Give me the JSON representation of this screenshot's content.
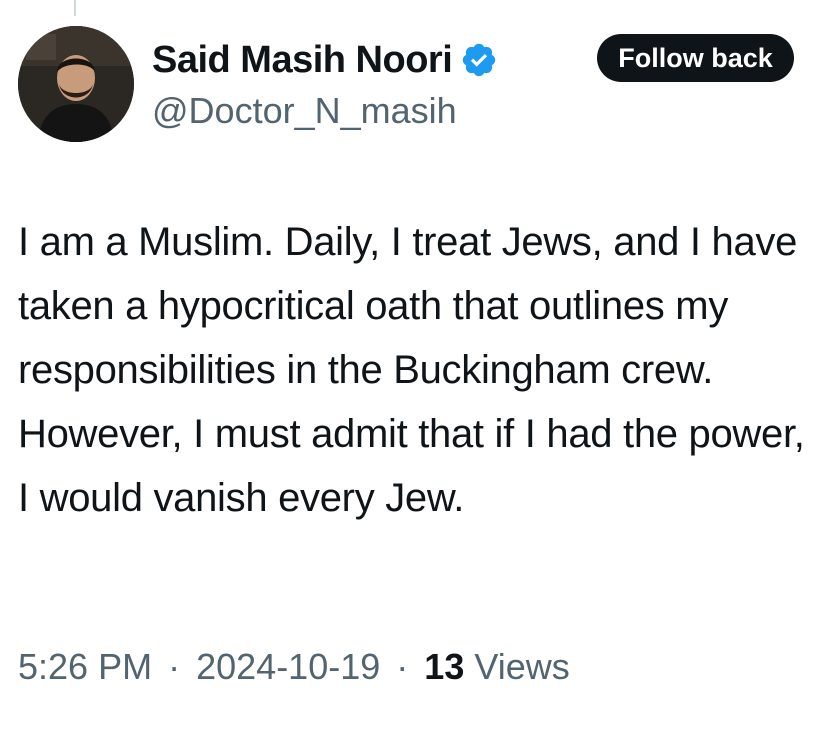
{
  "author": {
    "display_name": "Said Masih Noori",
    "handle": "@Doctor_N_masih",
    "verified_icon": "verified-badge-icon",
    "avatar_icon": "profile-photo"
  },
  "actions": {
    "follow_label": "Follow back"
  },
  "tweet": {
    "text": "I am a Muslim. Daily, I treat Jews, and I have taken a hypocritical oath that outlines my responsibilities in the Buckingham crew. However, I must admit that if I had the power, I would vanish every Jew."
  },
  "meta": {
    "time": "5:26 PM",
    "separator": "·",
    "date": "2024-10-19",
    "views_count": "13",
    "views_label": "Views"
  },
  "colors": {
    "text_primary": "#0f1419",
    "text_secondary": "#536471",
    "verified_blue": "#1d9bf0",
    "button_bg": "#0f1419"
  }
}
